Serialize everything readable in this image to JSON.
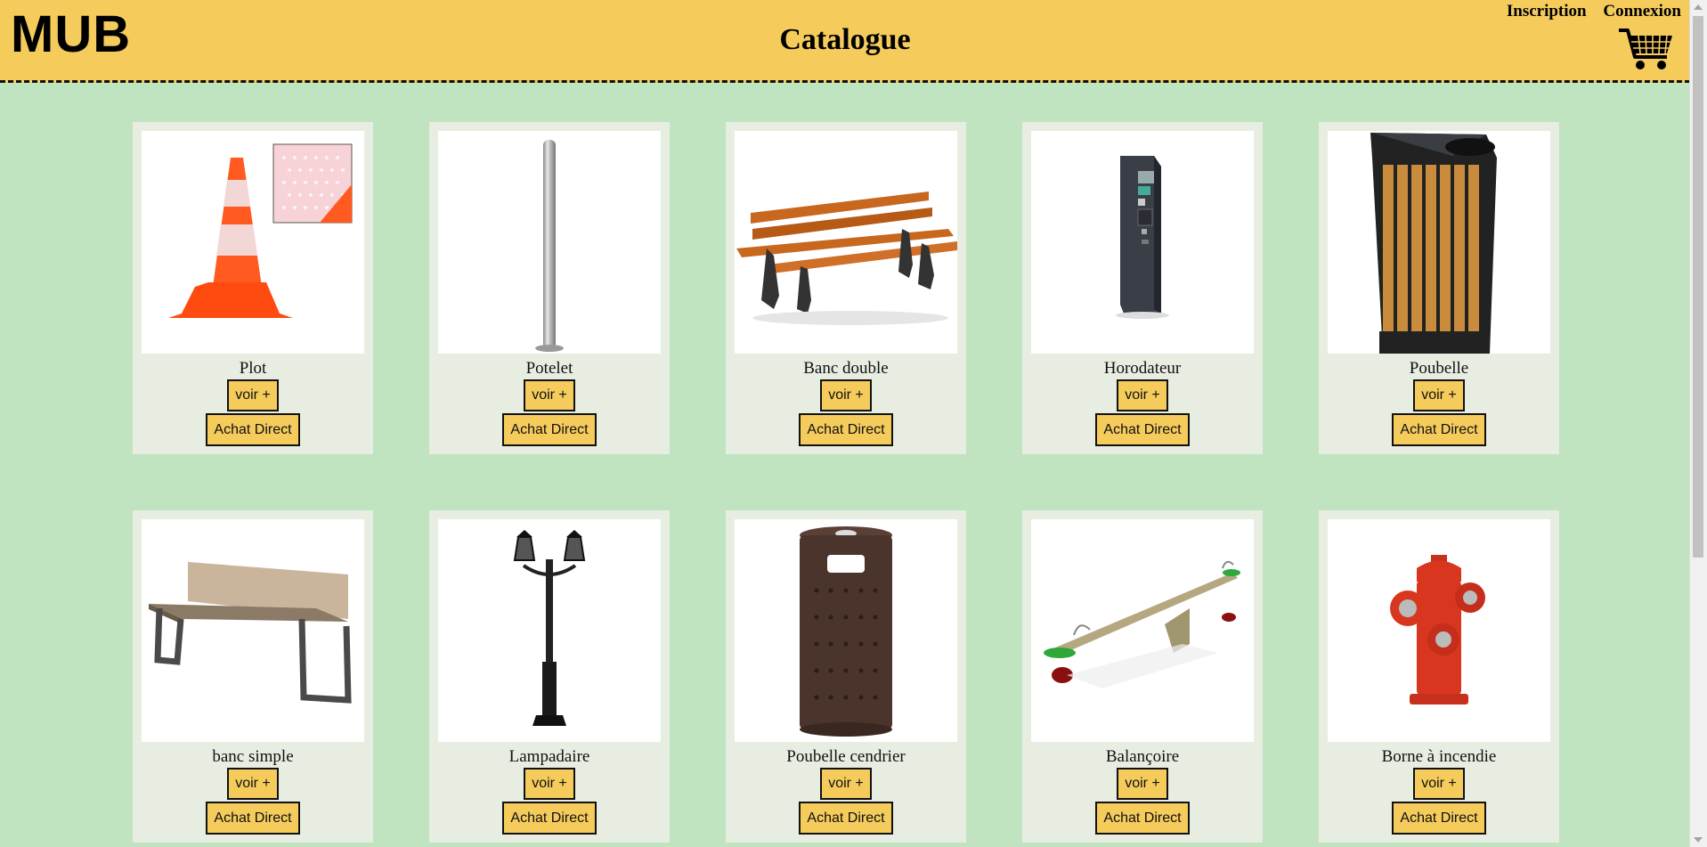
{
  "header": {
    "logo": "MUB",
    "title": "Catalogue",
    "signup_label": "Inscription",
    "login_label": "Connexion",
    "cart_icon": "cart-icon",
    "background_color": "#f5cb5c"
  },
  "page": {
    "background_color": "#c0e3c0",
    "card_color": "#e8ede2"
  },
  "products": [
    {
      "name": "Plot",
      "image": "traffic-cone-image",
      "view_label": "voir +",
      "buy_label": "Achat Direct"
    },
    {
      "name": "Potelet",
      "image": "bollard-image",
      "view_label": "voir +",
      "buy_label": "Achat Direct"
    },
    {
      "name": "Banc double",
      "image": "double-bench-image",
      "view_label": "voir +",
      "buy_label": "Achat Direct"
    },
    {
      "name": "Horodateur",
      "image": "parking-meter-image",
      "view_label": "voir +",
      "buy_label": "Achat Direct"
    },
    {
      "name": "Poubelle",
      "image": "wooden-bin-image",
      "view_label": "voir +",
      "buy_label": "Achat Direct"
    },
    {
      "name": "banc simple",
      "image": "simple-bench-image",
      "view_label": "voir +",
      "buy_label": "Achat Direct"
    },
    {
      "name": "Lampadaire",
      "image": "street-lamp-image",
      "view_label": "voir +",
      "buy_label": "Achat Direct"
    },
    {
      "name": "Poubelle cendrier",
      "image": "ashtray-bin-image",
      "view_label": "voir +",
      "buy_label": "Achat Direct"
    },
    {
      "name": "Balançoire",
      "image": "seesaw-image",
      "view_label": "voir +",
      "buy_label": "Achat Direct"
    },
    {
      "name": "Borne à incendie",
      "image": "fire-hydrant-image",
      "view_label": "voir +",
      "buy_label": "Achat Direct"
    }
  ]
}
